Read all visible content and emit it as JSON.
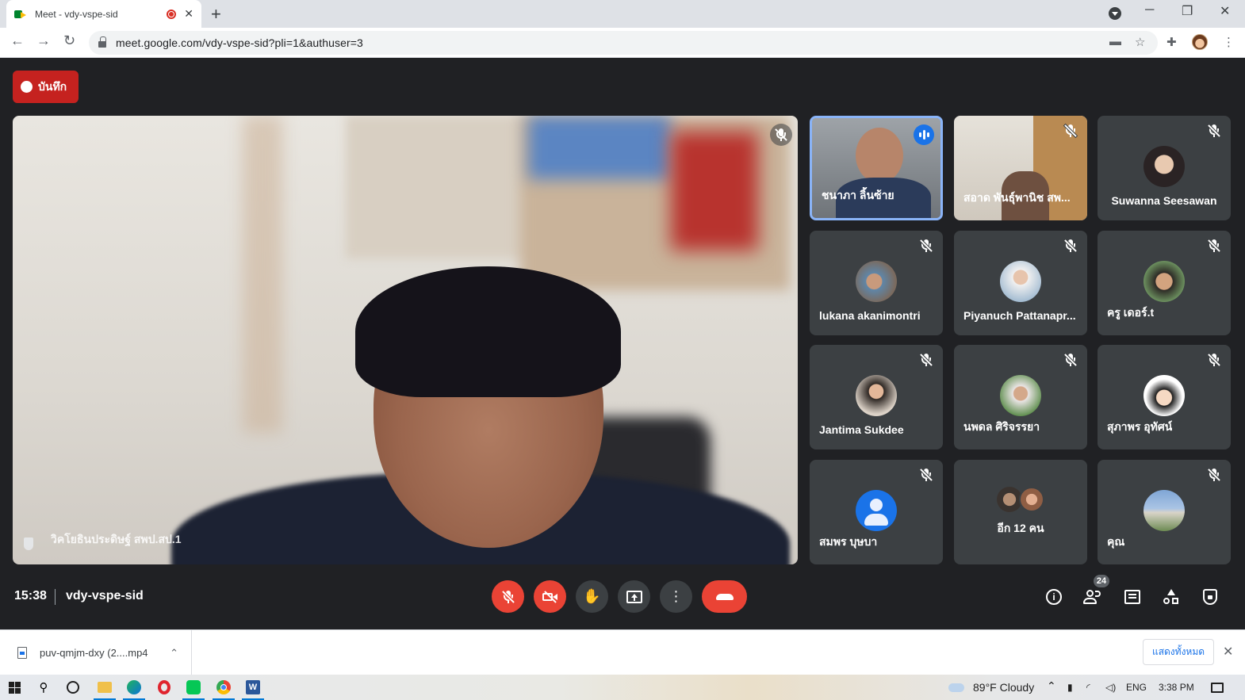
{
  "browser": {
    "tab_title": "Meet - vdy-vspe-sid",
    "tab_close": "✕",
    "new_tab": "+",
    "url": "meet.google.com/vdy-vspe-sid?pli=1&authuser=3",
    "window_minimize": "─",
    "window_restore": "❐",
    "window_close": "✕",
    "back": "←",
    "forward": "→",
    "reload": "↻"
  },
  "meet": {
    "record_label": "บันทึก",
    "main_speaker_name": "วิคโยธินประดิษฐ์ สพป.สป.1",
    "time": "15:38",
    "meeting_code": "vdy-vspe-sid",
    "participant_count": "24",
    "tiles": [
      {
        "name": "ชนาภา ลิ้นซ้าย",
        "speaking": true
      },
      {
        "name": "สอาด พันธุ์พานิช สพ..."
      },
      {
        "name": "Suwanna Seesawan"
      },
      {
        "name": "lukana akanimontri"
      },
      {
        "name": "Piyanuch Pattanapr..."
      },
      {
        "name": "ครู เดอร์.t"
      },
      {
        "name": "Jantima Sukdee"
      },
      {
        "name": "นพดล ศิริจรรยา"
      },
      {
        "name": "สุภาพร อุทัศน์"
      },
      {
        "name": "สมพร บุษบา"
      },
      {
        "name": "อีก 12 คน"
      },
      {
        "name": "คุณ"
      }
    ]
  },
  "downloads": {
    "file_name": "puv-qmjm-dxy (2....mp4",
    "show_all": "แสดงทั้งหมด",
    "close": "✕"
  },
  "taskbar": {
    "weather": "89°F  Cloudy",
    "language": "ENG",
    "clock": "3:38 PM"
  },
  "colors": {
    "meet_bg": "#202124",
    "tile_bg": "#3c4043",
    "record_red": "#c5221f",
    "hangup_red": "#ea4335",
    "active_speaker_border": "#8ab4f8",
    "link_blue": "#1a73e8"
  }
}
